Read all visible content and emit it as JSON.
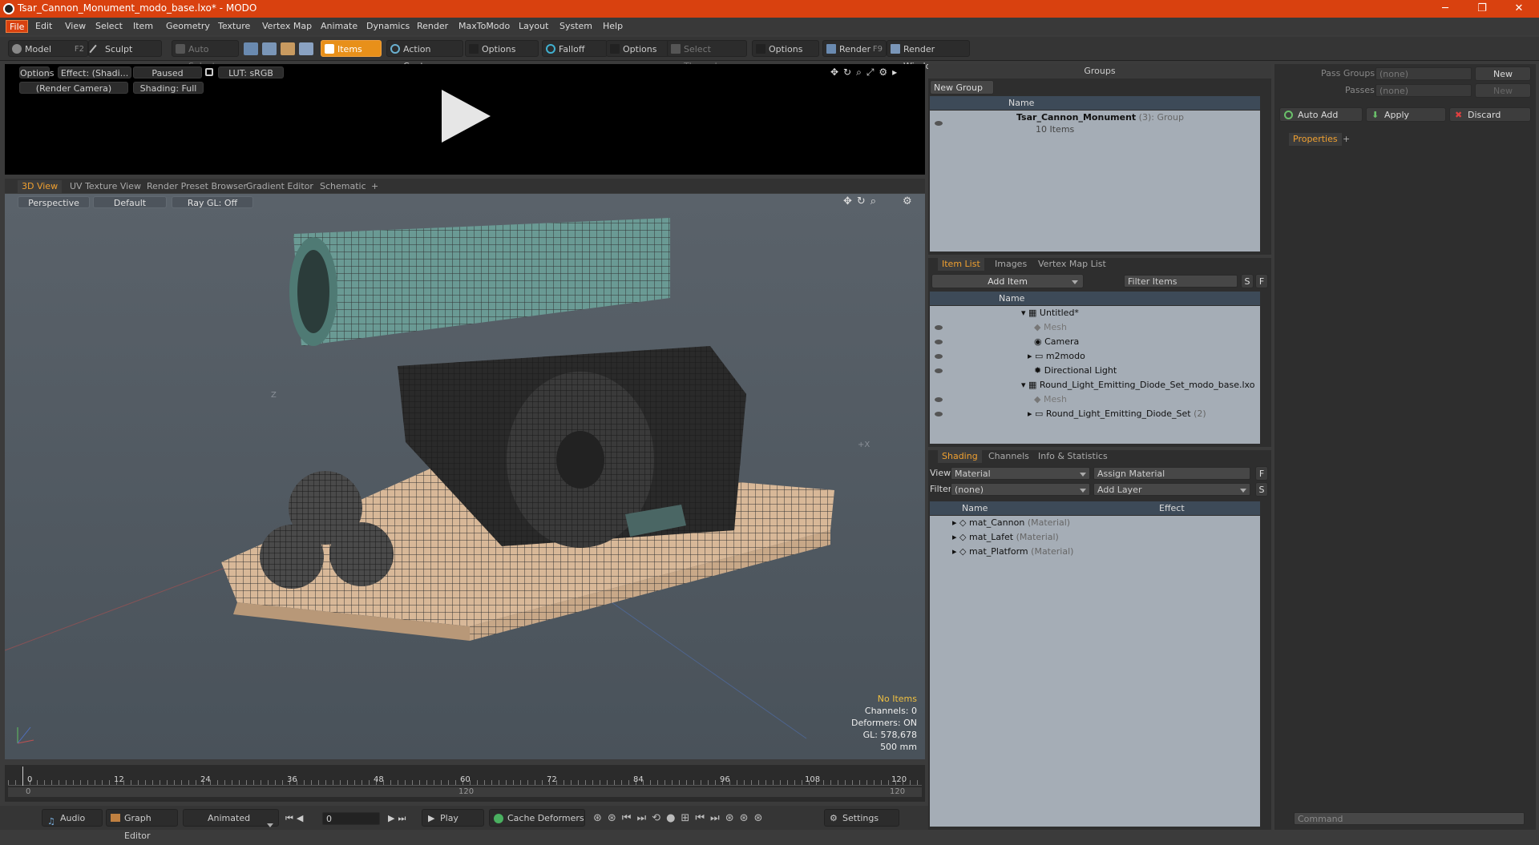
{
  "window": {
    "title": "Tsar_Cannon_Monument_modo_base.lxo* - MODO"
  },
  "menu": [
    "File",
    "Edit",
    "View",
    "Select",
    "Item",
    "Geometry",
    "Texture",
    "Vertex Map",
    "Animate",
    "Dynamics",
    "Render",
    "MaxToModo",
    "Layout",
    "System",
    "Help"
  ],
  "toolbar": {
    "model": "Model",
    "model_key": "F2",
    "sculpt": "Sculpt",
    "auto_select": "Auto Select",
    "items": "Items",
    "action_center": "Action Center",
    "options1": "Options",
    "falloff": "Falloff",
    "options2": "Options",
    "select_through": "Select Through",
    "options3": "Options",
    "render": "Render",
    "render_key": "F9",
    "render_window": "Render Window"
  },
  "preview": {
    "options": "Options",
    "effect": "Effect: (Shadi...",
    "paused": "Paused",
    "lut": "LUT: sRGB",
    "camera": "(Render Camera)",
    "shading": "Shading: Full"
  },
  "viewtabs": [
    "3D View",
    "UV Texture View",
    "Render Preset Browser",
    "Gradient Editor",
    "Schematic"
  ],
  "viewport": {
    "perspective": "Perspective",
    "default": "Default",
    "raygl": "Ray GL: Off",
    "axis_z": "Z",
    "axis_x": "+X"
  },
  "stats": {
    "no_items": "No Items",
    "channels": "Channels: 0",
    "deformers": "Deformers: ON",
    "gl": "GL: 578,678",
    "size": "500 mm"
  },
  "timeline": {
    "ticks": [
      "0",
      "12",
      "24",
      "36",
      "48",
      "60",
      "72",
      "84",
      "96",
      "108",
      "120"
    ],
    "sub_start": "0",
    "sub_mid": "120",
    "sub_end": "120"
  },
  "bottombar": {
    "audio": "Audio",
    "graph_editor": "Graph Editor",
    "animated": "Animated",
    "frame": "0",
    "play": "Play",
    "cache": "Cache Deformers",
    "settings": "Settings"
  },
  "groups": {
    "title": "Groups",
    "new_group": "New Group",
    "col_name": "Name",
    "item_name": "Tsar_Cannon_Monument",
    "item_count": "(3)",
    "item_type": ": Group",
    "item_sub": "10 Items"
  },
  "itemlist": {
    "tabs": [
      "Item List",
      "Images",
      "Vertex Map List"
    ],
    "add_item": "Add Item",
    "filter": "Filter Items",
    "s": "S",
    "f": "F",
    "col_name": "Name",
    "rows": [
      {
        "label": "Untitled*",
        "suffix": ""
      },
      {
        "label": "Mesh",
        "suffix": ""
      },
      {
        "label": "Camera",
        "suffix": ""
      },
      {
        "label": "m2modo",
        "suffix": ""
      },
      {
        "label": "Directional Light",
        "suffix": ""
      },
      {
        "label": "Round_Light_Emitting_Diode_Set_modo_base.lxo",
        "suffix": ""
      },
      {
        "label": "Mesh",
        "suffix": ""
      },
      {
        "label": "Round_Light_Emitting_Diode_Set",
        "suffix": "(2)"
      }
    ]
  },
  "shading": {
    "tabs": [
      "Shading",
      "Channels",
      "Info & Statistics"
    ],
    "view_label": "View",
    "view_value": "Material",
    "assign": "Assign Material",
    "filter_label": "Filter",
    "filter_value": "(none)",
    "add_layer": "Add Layer",
    "f": "F",
    "s": "S",
    "col_name": "Name",
    "col_effect": "Effect",
    "rows": [
      {
        "name": "mat_Cannon",
        "type": "(Material)"
      },
      {
        "name": "mat_Lafet",
        "type": "(Material)"
      },
      {
        "name": "mat_Platform",
        "type": "(Material)"
      }
    ]
  },
  "props": {
    "pass_groups": "Pass Groups",
    "passes": "Passes",
    "none1": "(none)",
    "none2": "(none)",
    "new1": "New",
    "new2": "New",
    "auto_add": "Auto Add",
    "apply": "Apply",
    "discard": "Discard",
    "tab": "Properties",
    "command": "Command"
  }
}
